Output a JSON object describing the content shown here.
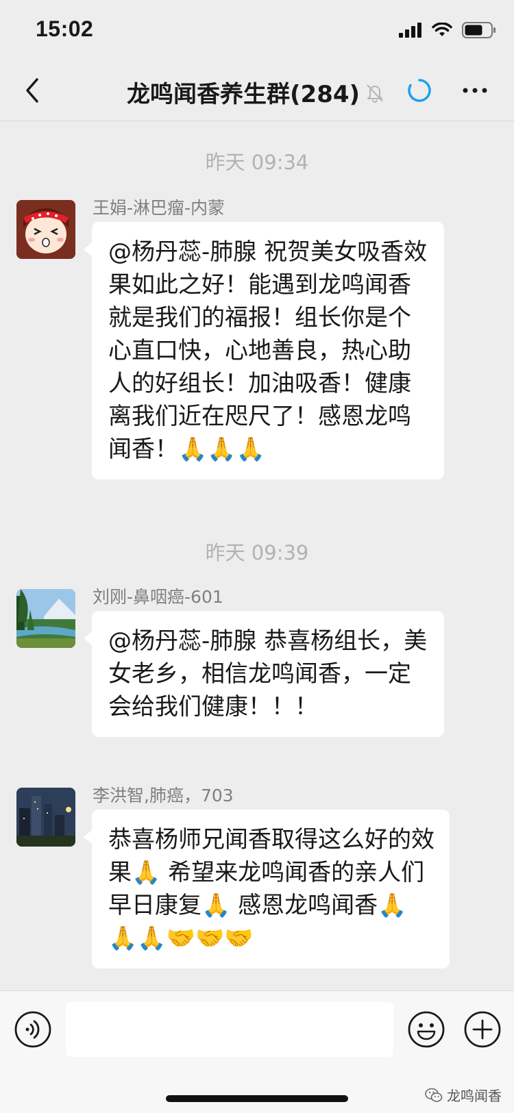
{
  "status": {
    "time": "15:02"
  },
  "nav": {
    "title": "龙鸣闻香养生群(284)"
  },
  "messages": [
    {
      "timestamp": "昨天 09:34",
      "sender": "王娟-淋巴瘤-内蒙",
      "text": "@杨丹蕊-肺腺 祝贺美女吸香效果如此之好！能遇到龙鸣闻香就是我们的福报！组长你是个心直口快，心地善良，热心助人的好组长！加油吸香！健康离我们近在咫尺了！感恩龙鸣闻香！🙏🙏🙏"
    },
    {
      "timestamp": "昨天 09:39",
      "sender": "刘刚-鼻咽癌-601",
      "text": "@杨丹蕊-肺腺 恭喜杨组长，美女老乡，相信龙鸣闻香，一定会给我们健康！！！"
    },
    {
      "sender": "李洪智,肺癌，703",
      "text": " 恭喜杨师兄闻香取得这么好的效果🙏 希望来龙鸣闻香的亲人们早日康复🙏 感恩龙鸣闻香🙏🙏🙏🤝🤝🤝"
    }
  ],
  "watermark": {
    "text": "龙鸣闻香"
  },
  "icons": {
    "back": "chevron-left-icon",
    "mute": "bell-slash-icon",
    "loading": "loading-ring-icon",
    "more": "more-dots-icon",
    "voice": "voice-icon",
    "emoji": "emoji-icon",
    "plus": "plus-icon"
  },
  "colors": {
    "background": "#ededed",
    "bubble": "#ffffff",
    "accent": "#1aa1f0"
  }
}
